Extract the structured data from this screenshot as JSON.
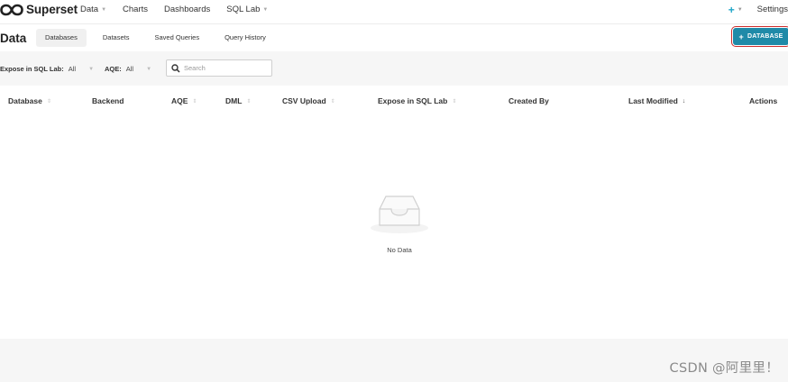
{
  "app": {
    "brand": "Superset"
  },
  "nav": {
    "items": [
      {
        "label": "Data",
        "has_caret": true
      },
      {
        "label": "Charts",
        "has_caret": false
      },
      {
        "label": "Dashboards",
        "has_caret": false
      },
      {
        "label": "SQL Lab",
        "has_caret": true
      }
    ],
    "plus_icon": "plus-icon",
    "settings_label": "Settings"
  },
  "subheader": {
    "title": "Data",
    "tabs": [
      {
        "label": "Databases",
        "active": true
      },
      {
        "label": "Datasets",
        "active": false
      },
      {
        "label": "Saved Queries",
        "active": false
      },
      {
        "label": "Query History",
        "active": false
      }
    ],
    "add_button_label": "DATABASE"
  },
  "filters": {
    "expose": {
      "label": "Expose in SQL Lab:",
      "value": "All"
    },
    "aqe": {
      "label": "AQE:",
      "value": "All"
    },
    "search_placeholder": "Search"
  },
  "table": {
    "columns": [
      {
        "label": "Database",
        "sort": "both"
      },
      {
        "label": "Backend",
        "sort": "none"
      },
      {
        "label": "AQE",
        "sort": "both"
      },
      {
        "label": "DML",
        "sort": "both"
      },
      {
        "label": "CSV Upload",
        "sort": "both"
      },
      {
        "label": "Expose in SQL Lab",
        "sort": "both"
      },
      {
        "label": "Created By",
        "sort": "none"
      },
      {
        "label": "Last Modified",
        "sort": "desc"
      },
      {
        "label": "Actions",
        "sort": "none"
      }
    ],
    "empty_text": "No Data"
  },
  "watermark": "CSDN @阿里里！",
  "colors": {
    "accent": "#1f8aa8",
    "plus": "#20a7c9",
    "highlight_border": "#cc2c2c"
  }
}
